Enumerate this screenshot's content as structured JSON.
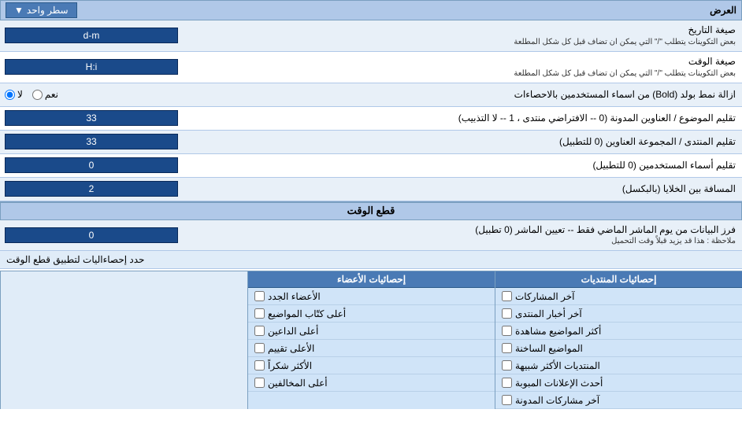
{
  "page": {
    "title": "العرض",
    "dropdown_label": "سطر واحد",
    "rows": [
      {
        "id": "date_format",
        "label": "صيغة التاريخ",
        "sublabel": "بعض التكوينات يتطلب \"/\" التي يمكن ان تضاف قبل كل شكل المطلعة",
        "input_value": "d-m",
        "type": "text"
      },
      {
        "id": "time_format",
        "label": "صيغة الوقت",
        "sublabel": "بعض التكوينات يتطلب \"/\" التي يمكن ان تضاف قبل كل شكل المطلعة",
        "input_value": "H:i",
        "type": "text"
      },
      {
        "id": "remove_bold",
        "label": "ازالة نمط بولد (Bold) من اسماء المستخدمين بالاحصاءات",
        "type": "radio",
        "radio_options": [
          {
            "label": "نعم",
            "name": "bold_opt",
            "value": "yes"
          },
          {
            "label": "لا",
            "name": "bold_opt",
            "value": "no",
            "checked": true
          }
        ]
      },
      {
        "id": "topics_titles",
        "label": "تقليم الموضوع / العناوين المدونة (0 -- الافتراضي منتدى ، 1 -- لا التذبيب)",
        "input_value": "33",
        "type": "text"
      },
      {
        "id": "forum_titles",
        "label": "تقليم المنتدى / المجموعة العناوين (0 للتطبيل)",
        "input_value": "33",
        "type": "text"
      },
      {
        "id": "usernames",
        "label": "تقليم أسماء المستخدمين (0 للتطبيل)",
        "input_value": "0",
        "type": "text"
      },
      {
        "id": "spacing",
        "label": "المسافة بين الخلايا (بالبكسل)",
        "input_value": "2",
        "type": "text"
      }
    ],
    "cutoff_section": {
      "header": "قطع الوقت",
      "filter_row": {
        "label": "فرز البيانات من يوم الماشر الماضي فقط -- تعيين الماشر (0 تطبيل)",
        "note": "ملاحظة : هذا قد يزيد قبلاً وقت التحميل",
        "input_value": "0"
      },
      "limit_row": {
        "label": "حدد إحصاءاليات لتطبيق قطع الوقت"
      }
    },
    "checkbox_columns": [
      {
        "header": "إحصائيات المنتديات",
        "items": [
          {
            "label": "آخر المشاركات",
            "checked": false
          },
          {
            "label": "آخر أخبار المنتدى",
            "checked": false
          },
          {
            "label": "أكثر المواضيع مشاهدة",
            "checked": false
          },
          {
            "label": "المواضيع الساخنة",
            "checked": false
          },
          {
            "label": "المنتديات الأكثر شبيهة",
            "checked": false
          },
          {
            "label": "أحدث الإعلانات المبوبة",
            "checked": false
          },
          {
            "label": "آخر مشاركات المدونة",
            "checked": false
          }
        ]
      },
      {
        "header": "إحصائيات الأعضاء",
        "items": [
          {
            "label": "الأعضاء الجدد",
            "checked": false
          },
          {
            "label": "أعلى كتّاب المواضيع",
            "checked": false
          },
          {
            "label": "أعلى الداعين",
            "checked": false
          },
          {
            "label": "الأعلى تقييم",
            "checked": false
          },
          {
            "label": "الأكثر شكراً",
            "checked": false
          },
          {
            "label": "أعلى المخالفين",
            "checked": false
          }
        ]
      }
    ]
  }
}
